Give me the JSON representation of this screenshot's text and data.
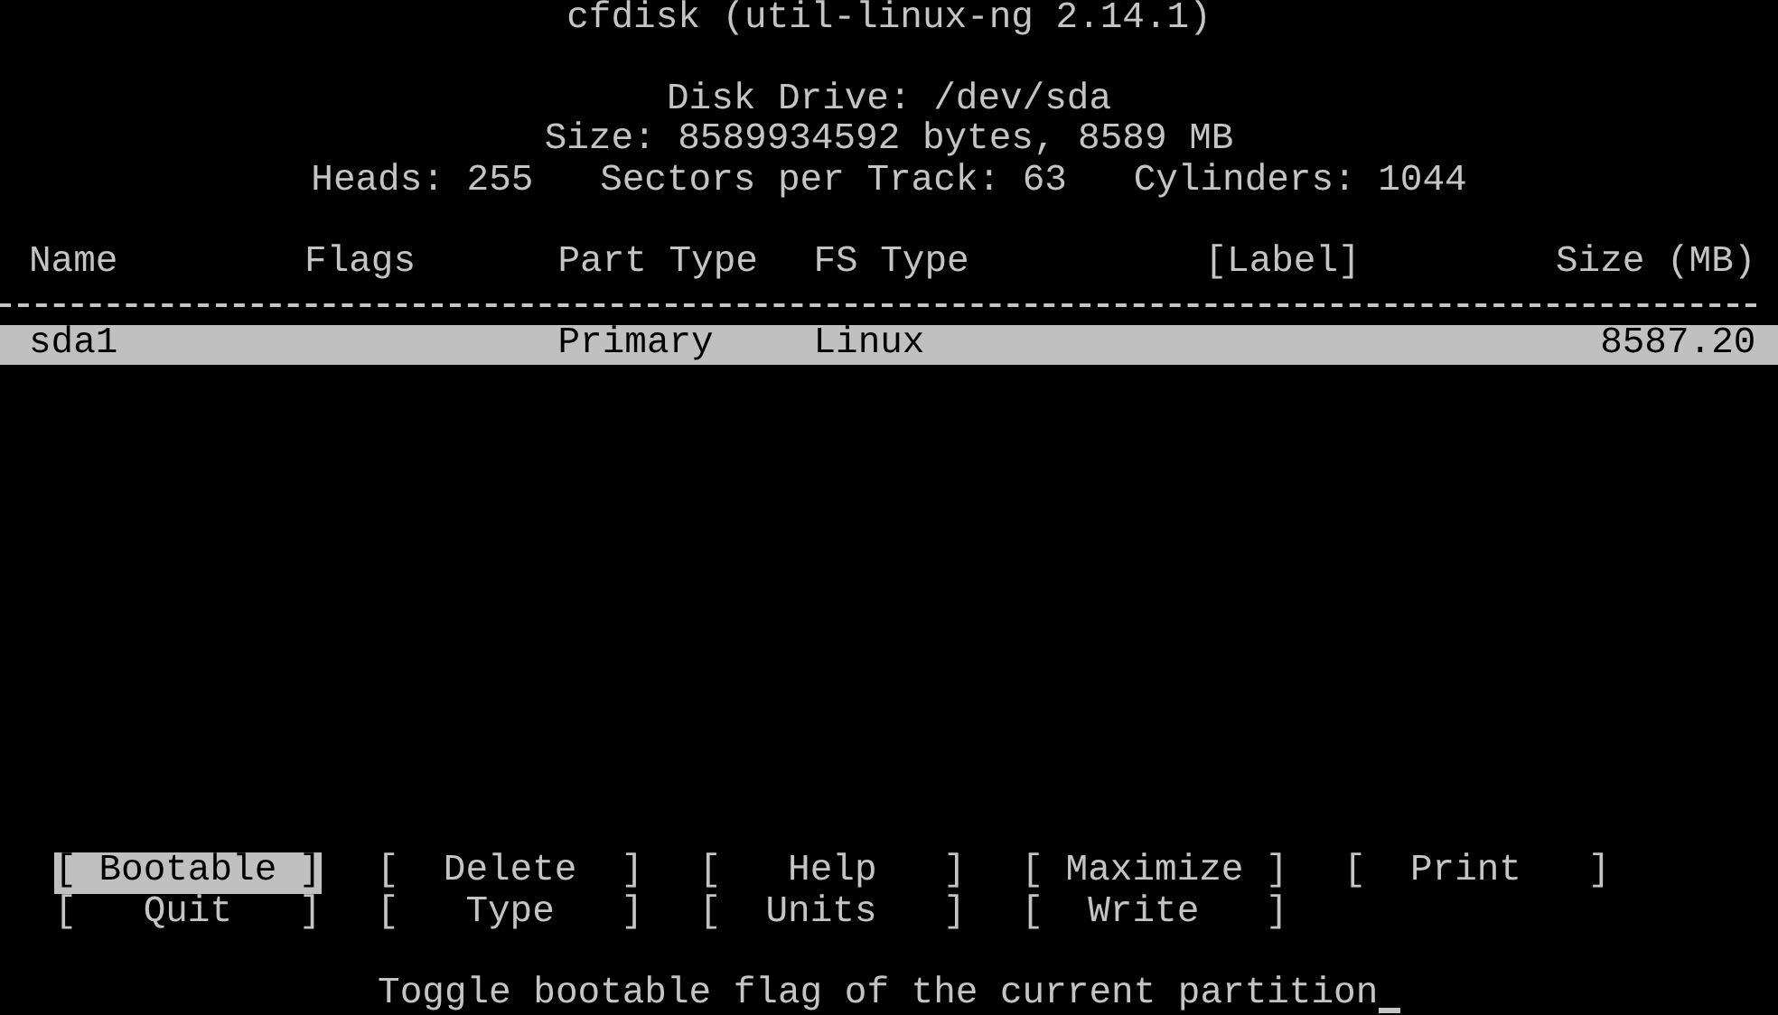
{
  "title": "cfdisk (util-linux-ng 2.14.1)",
  "disk": {
    "drive": "Disk Drive: /dev/sda",
    "size": "Size: 8589934592 bytes, 8589 MB",
    "geometry": [
      "Heads: 255",
      "Sectors per Track: 63",
      "Cylinders: 1044"
    ]
  },
  "table": {
    "columns": [
      "Name",
      "Flags",
      "Part Type",
      "FS Type",
      "[Label]",
      "Size (MB)"
    ],
    "rows": [
      {
        "cells": [
          "sda1",
          "",
          "Primary",
          "Linux",
          "",
          "8587.20"
        ],
        "selected": true
      }
    ]
  },
  "menu": [
    {
      "label": "[ Bootable ]",
      "selected": true
    },
    {
      "label": "[  Delete  ]",
      "selected": false
    },
    {
      "label": "[   Help   ]",
      "selected": false
    },
    {
      "label": "[ Maximize ]",
      "selected": false
    },
    {
      "label": "[  Print   ]",
      "selected": false
    },
    {
      "label": "[   Quit   ]",
      "selected": false
    },
    {
      "label": "[   Type   ]",
      "selected": false
    },
    {
      "label": "[  Units   ]",
      "selected": false
    },
    {
      "label": "[  Write   ]",
      "selected": false
    }
  ],
  "status": "Toggle bootable flag of the current partition"
}
